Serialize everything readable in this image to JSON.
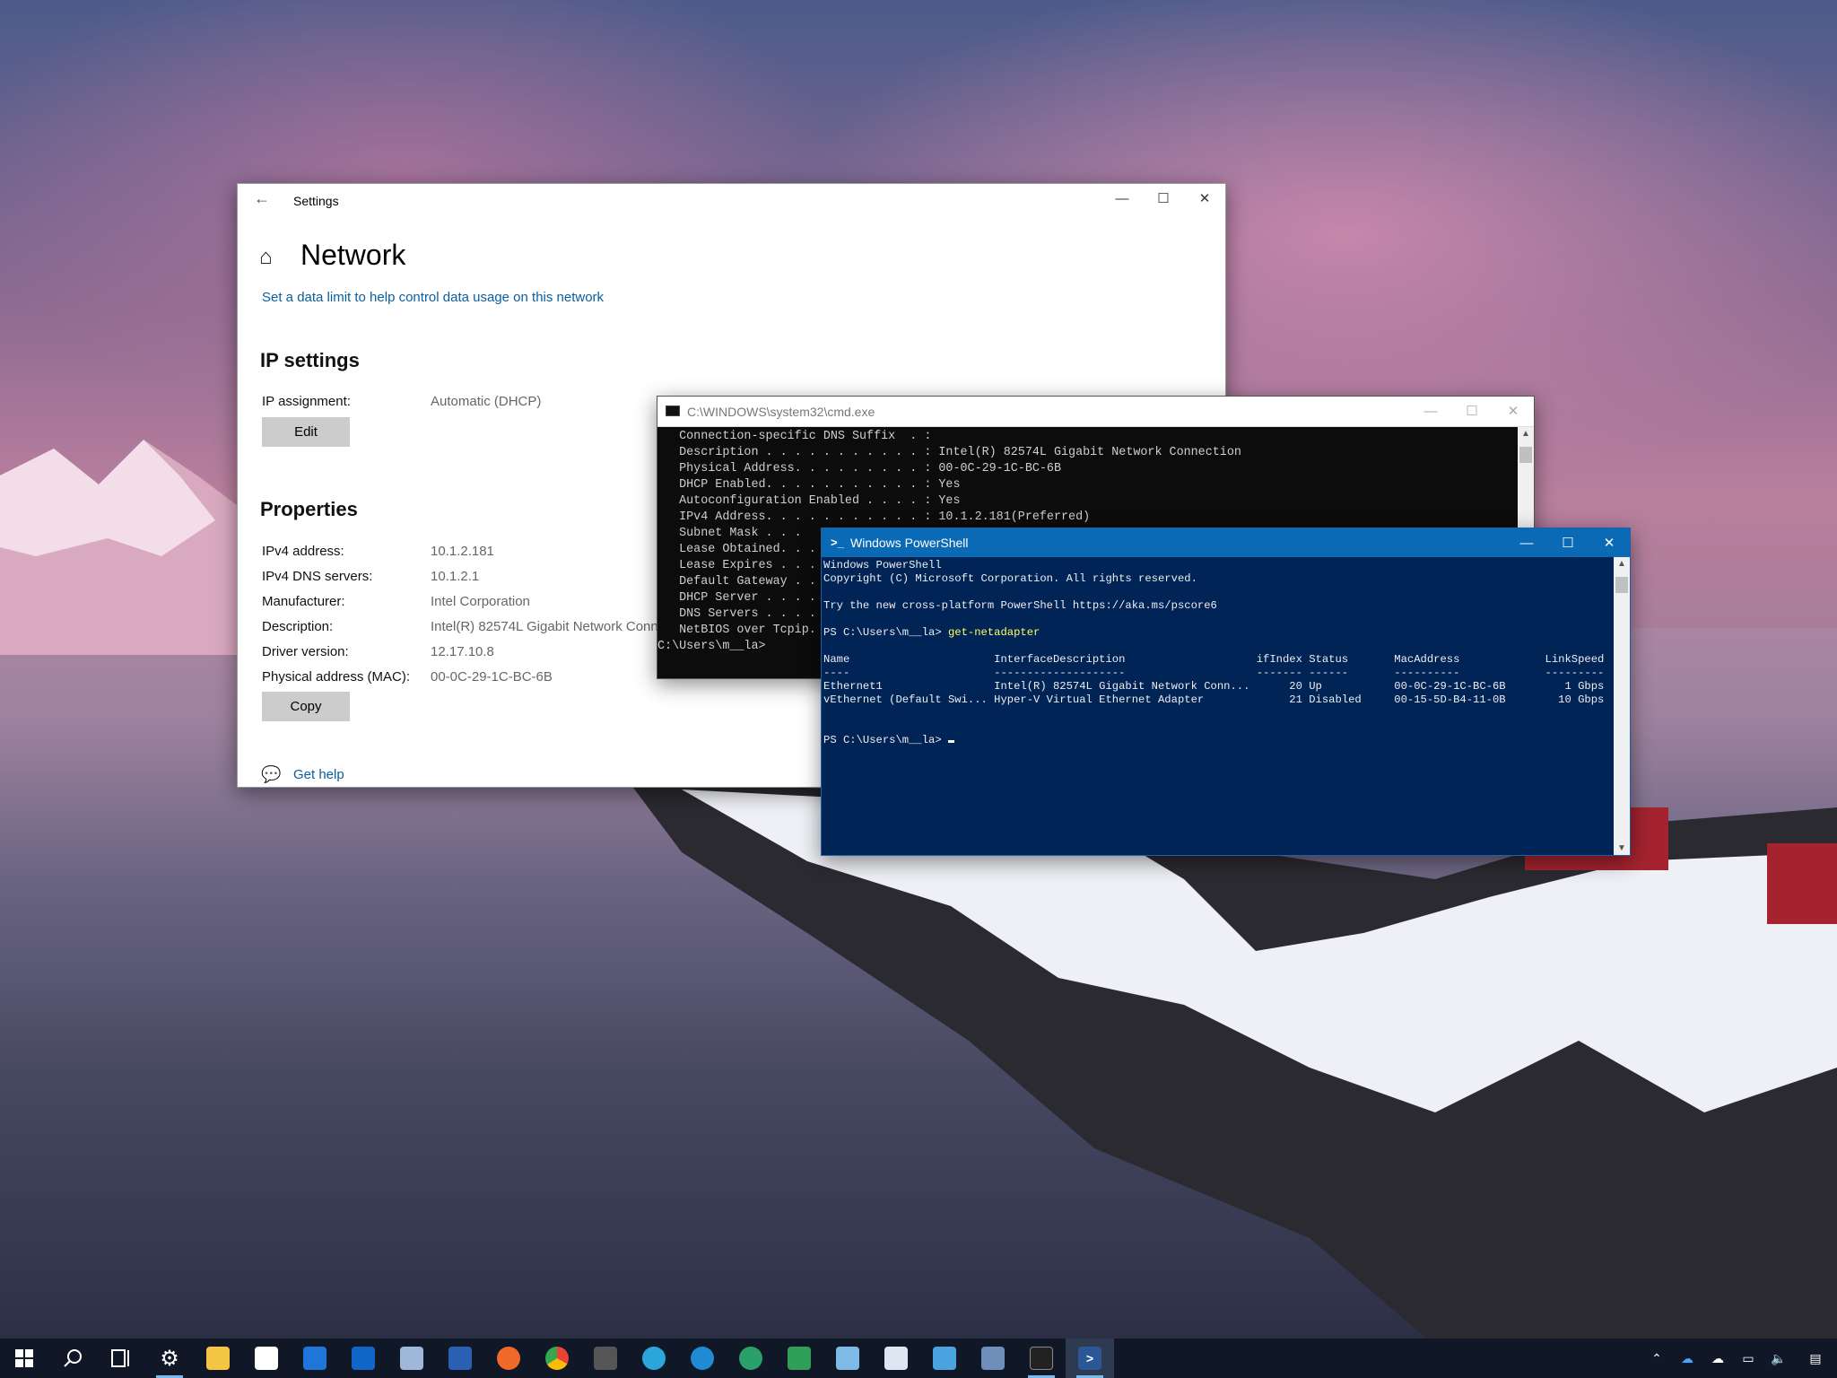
{
  "settings": {
    "title": "Settings",
    "page_title": "Network",
    "data_limit_link": "Set a data limit to help control data usage on this network",
    "ip_settings_heading": "IP settings",
    "ip_assignment_label": "IP assignment:",
    "ip_assignment_value": "Automatic (DHCP)",
    "edit_button": "Edit",
    "properties_heading": "Properties",
    "properties": [
      {
        "label": "IPv4 address:",
        "value": "10.1.2.181"
      },
      {
        "label": "IPv4 DNS servers:",
        "value": "10.1.2.1"
      },
      {
        "label": "Manufacturer:",
        "value": "Intel Corporation"
      },
      {
        "label": "Description:",
        "value": "Intel(R) 82574L Gigabit Network Conn"
      },
      {
        "label": "Driver version:",
        "value": "12.17.10.8"
      },
      {
        "label": "Physical address (MAC):",
        "value": "00-0C-29-1C-BC-6B"
      }
    ],
    "copy_button": "Copy",
    "get_help_link": "Get help"
  },
  "cmd": {
    "title": "C:\\WINDOWS\\system32\\cmd.exe",
    "lines": [
      "   Connection-specific DNS Suffix  . :",
      "   Description . . . . . . . . . . . : Intel(R) 82574L Gigabit Network Connection",
      "   Physical Address. . . . . . . . . : 00-0C-29-1C-BC-6B",
      "   DHCP Enabled. . . . . . . . . . . : Yes",
      "   Autoconfiguration Enabled . . . . : Yes",
      "   IPv4 Address. . . . . . . . . . . : 10.1.2.181(Preferred)",
      "   Subnet Mask . . . ",
      "   Lease Obtained. . . ",
      "   Lease Expires . . . ",
      "   Default Gateway . . ",
      "   DHCP Server . . . . ",
      "   DNS Servers . . . . ",
      "   NetBIOS over Tcpip.",
      "",
      "C:\\Users\\m__la>"
    ]
  },
  "powershell": {
    "title": "Windows PowerShell",
    "header_lines": [
      "Windows PowerShell",
      "Copyright (C) Microsoft Corporation. All rights reserved.",
      "",
      "Try the new cross-platform PowerShell https://aka.ms/pscore6",
      ""
    ],
    "prompt": "PS C:\\Users\\m__la> ",
    "command": "get-netadapter",
    "table_lines": [
      "",
      "Name                      InterfaceDescription                    ifIndex Status       MacAddress             LinkSpeed",
      "----                      --------------------                    ------- ------       ----------             ---------",
      "Ethernet1                 Intel(R) 82574L Gigabit Network Conn...      20 Up           00-0C-29-1C-BC-6B         1 Gbps",
      "vEthernet (Default Swi... Hyper-V Virtual Ethernet Adapter             21 Disabled     00-15-5D-B4-11-0B        10 Gbps",
      "",
      ""
    ],
    "final_prompt": "PS C:\\Users\\m__la> "
  },
  "window_controls": {
    "minimize": "—",
    "maximize": "☐",
    "close": "✕"
  },
  "taskbar": {
    "apps": [
      {
        "name": "start-icon",
        "color": "#ffffff"
      },
      {
        "name": "search-icon",
        "color": "#ffffff"
      },
      {
        "name": "task-view-icon",
        "color": "#ffffff"
      },
      {
        "name": "settings-icon",
        "color": "#ffffff",
        "running": true
      },
      {
        "name": "file-explorer-icon",
        "color": "#f4c542"
      },
      {
        "name": "store-icon",
        "color": "#ffffff"
      },
      {
        "name": "mail-icon",
        "color": "#1d76d8"
      },
      {
        "name": "outlook-icon",
        "color": "#1066c7"
      },
      {
        "name": "photos-editor-icon",
        "color": "#9fb7d8"
      },
      {
        "name": "word-icon",
        "color": "#2b5fb4"
      },
      {
        "name": "firefox-icon",
        "color": "#ef6a28"
      },
      {
        "name": "chrome-icon",
        "color": "#34a853"
      },
      {
        "name": "terminal-icon",
        "color": "#555555"
      },
      {
        "name": "edge-icon",
        "color": "#2ba6dd"
      },
      {
        "name": "edge-beta-icon",
        "color": "#1f8bd5"
      },
      {
        "name": "edge-canary-icon",
        "color": "#2aa16a"
      },
      {
        "name": "sticky-app-icon",
        "color": "#2f9e57"
      },
      {
        "name": "notepad-icon",
        "color": "#7dbbe6"
      },
      {
        "name": "photos-icon",
        "color": "#dde7f2"
      },
      {
        "name": "control-panel-icon",
        "color": "#4aa3df"
      },
      {
        "name": "remote-desktop-icon",
        "color": "#6d8fb9"
      },
      {
        "name": "cmd-icon",
        "color": "#222222",
        "running": true
      },
      {
        "name": "powershell-icon",
        "color": "#2b5797",
        "running": true,
        "active": true
      }
    ],
    "tray": [
      "chevron-up-icon",
      "onedrive-icon",
      "cloud-icon",
      "network-icon",
      "volume-icon",
      "notifications-icon"
    ]
  }
}
